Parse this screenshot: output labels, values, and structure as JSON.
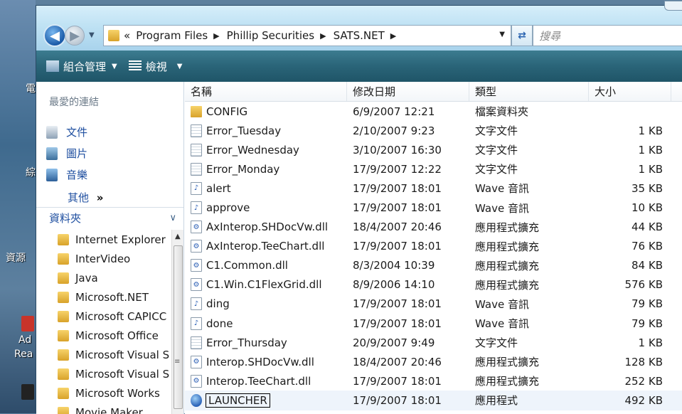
{
  "window": {
    "breadcrumb": {
      "overflow": "«",
      "parts": [
        "Program Files",
        "Phillip Securities",
        "SATS.NET"
      ]
    },
    "search_placeholder": "搜尋"
  },
  "command_bar": {
    "organize": "組合管理",
    "views": "檢視"
  },
  "navigation": {
    "favorites_title": "最愛的連結",
    "favorites": [
      "文件",
      "圖片",
      "音樂"
    ],
    "more": "其他",
    "more_glyph": "»",
    "folders_title": "資料夾",
    "folders": [
      "Internet Explorer",
      "InterVideo",
      "Java",
      "Microsoft.NET",
      "Microsoft CAPICC",
      "Microsoft Office",
      "Microsoft Visual S",
      "Microsoft Visual S",
      "Microsoft Works",
      "Movie Maker"
    ]
  },
  "file_list": {
    "columns": {
      "name": "名稱",
      "date": "修改日期",
      "type": "類型",
      "size": "大小"
    },
    "files": [
      {
        "name": "CONFIG",
        "date": "6/9/2007 12:21",
        "type": "檔案資料夾",
        "size": "",
        "icon": "folder-icon"
      },
      {
        "name": "Error_Tuesday",
        "date": "2/10/2007 9:23",
        "type": "文字文件",
        "size": "1 KB",
        "icon": "text-file-icon"
      },
      {
        "name": "Error_Wednesday",
        "date": "3/10/2007 16:30",
        "type": "文字文件",
        "size": "1 KB",
        "icon": "text-file-icon"
      },
      {
        "name": "Error_Monday",
        "date": "17/9/2007 12:22",
        "type": "文字文件",
        "size": "1 KB",
        "icon": "text-file-icon"
      },
      {
        "name": "alert",
        "date": "17/9/2007 18:01",
        "type": "Wave 音訊",
        "size": "35 KB",
        "icon": "audio-file-icon"
      },
      {
        "name": "approve",
        "date": "17/9/2007 18:01",
        "type": "Wave 音訊",
        "size": "10 KB",
        "icon": "audio-file-icon"
      },
      {
        "name": "AxInterop.SHDocVw.dll",
        "date": "18/4/2007 20:46",
        "type": "應用程式擴充",
        "size": "44 KB",
        "icon": "dll-file-icon"
      },
      {
        "name": "AxInterop.TeeChart.dll",
        "date": "17/9/2007 18:01",
        "type": "應用程式擴充",
        "size": "76 KB",
        "icon": "dll-file-icon"
      },
      {
        "name": "C1.Common.dll",
        "date": "8/3/2004 10:39",
        "type": "應用程式擴充",
        "size": "84 KB",
        "icon": "dll-file-icon"
      },
      {
        "name": "C1.Win.C1FlexGrid.dll",
        "date": "8/9/2006 14:10",
        "type": "應用程式擴充",
        "size": "576 KB",
        "icon": "dll-file-icon"
      },
      {
        "name": "ding",
        "date": "17/9/2007 18:01",
        "type": "Wave 音訊",
        "size": "79 KB",
        "icon": "audio-file-icon"
      },
      {
        "name": "done",
        "date": "17/9/2007 18:01",
        "type": "Wave 音訊",
        "size": "79 KB",
        "icon": "audio-file-icon"
      },
      {
        "name": "Error_Thursday",
        "date": "20/9/2007 9:49",
        "type": "文字文件",
        "size": "1 KB",
        "icon": "text-file-icon"
      },
      {
        "name": "Interop.SHDocVw.dll",
        "date": "18/4/2007 20:46",
        "type": "應用程式擴充",
        "size": "128 KB",
        "icon": "dll-file-icon"
      },
      {
        "name": "Interop.TeeChart.dll",
        "date": "17/9/2007 18:01",
        "type": "應用程式擴充",
        "size": "252 KB",
        "icon": "dll-file-icon"
      },
      {
        "name": "LAUNCHER",
        "date": "17/9/2007 18:01",
        "type": "應用程式",
        "size": "492 KB",
        "icon": "application-icon"
      }
    ]
  },
  "desktop": {
    "labels": [
      "電",
      "綜",
      "資源",
      "Ad",
      "Rea"
    ]
  }
}
